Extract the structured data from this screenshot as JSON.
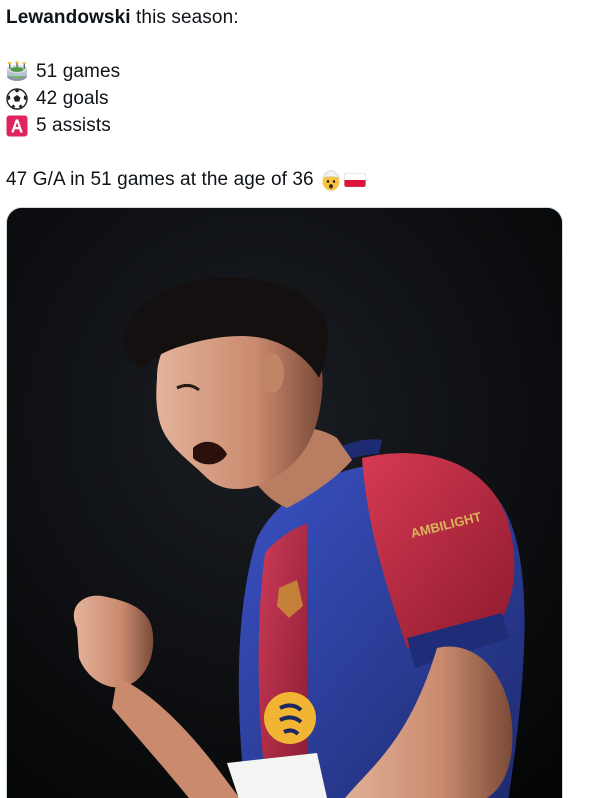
{
  "tweet": {
    "author": "Lewandowski",
    "intro": " this season:",
    "stats": [
      {
        "icon": "stadium-icon",
        "text": "51 games"
      },
      {
        "icon": "soccer-ball-icon",
        "text": "42 goals"
      },
      {
        "icon": "letter-a-icon",
        "text": "5 assists"
      }
    ],
    "summary": "47 G/A in 51 games at the age of 36",
    "summary_emojis": [
      "exploding-head-icon",
      "poland-flag-icon"
    ]
  },
  "media": {
    "kit_sponsor_text": "AMBILIGHT",
    "kit_colors": {
      "blue": "#2b3f9e",
      "red": "#b0243a"
    },
    "background": "#050607"
  },
  "colors": {
    "text": "#0f1419",
    "letter_a_badge": "#e0245e"
  }
}
